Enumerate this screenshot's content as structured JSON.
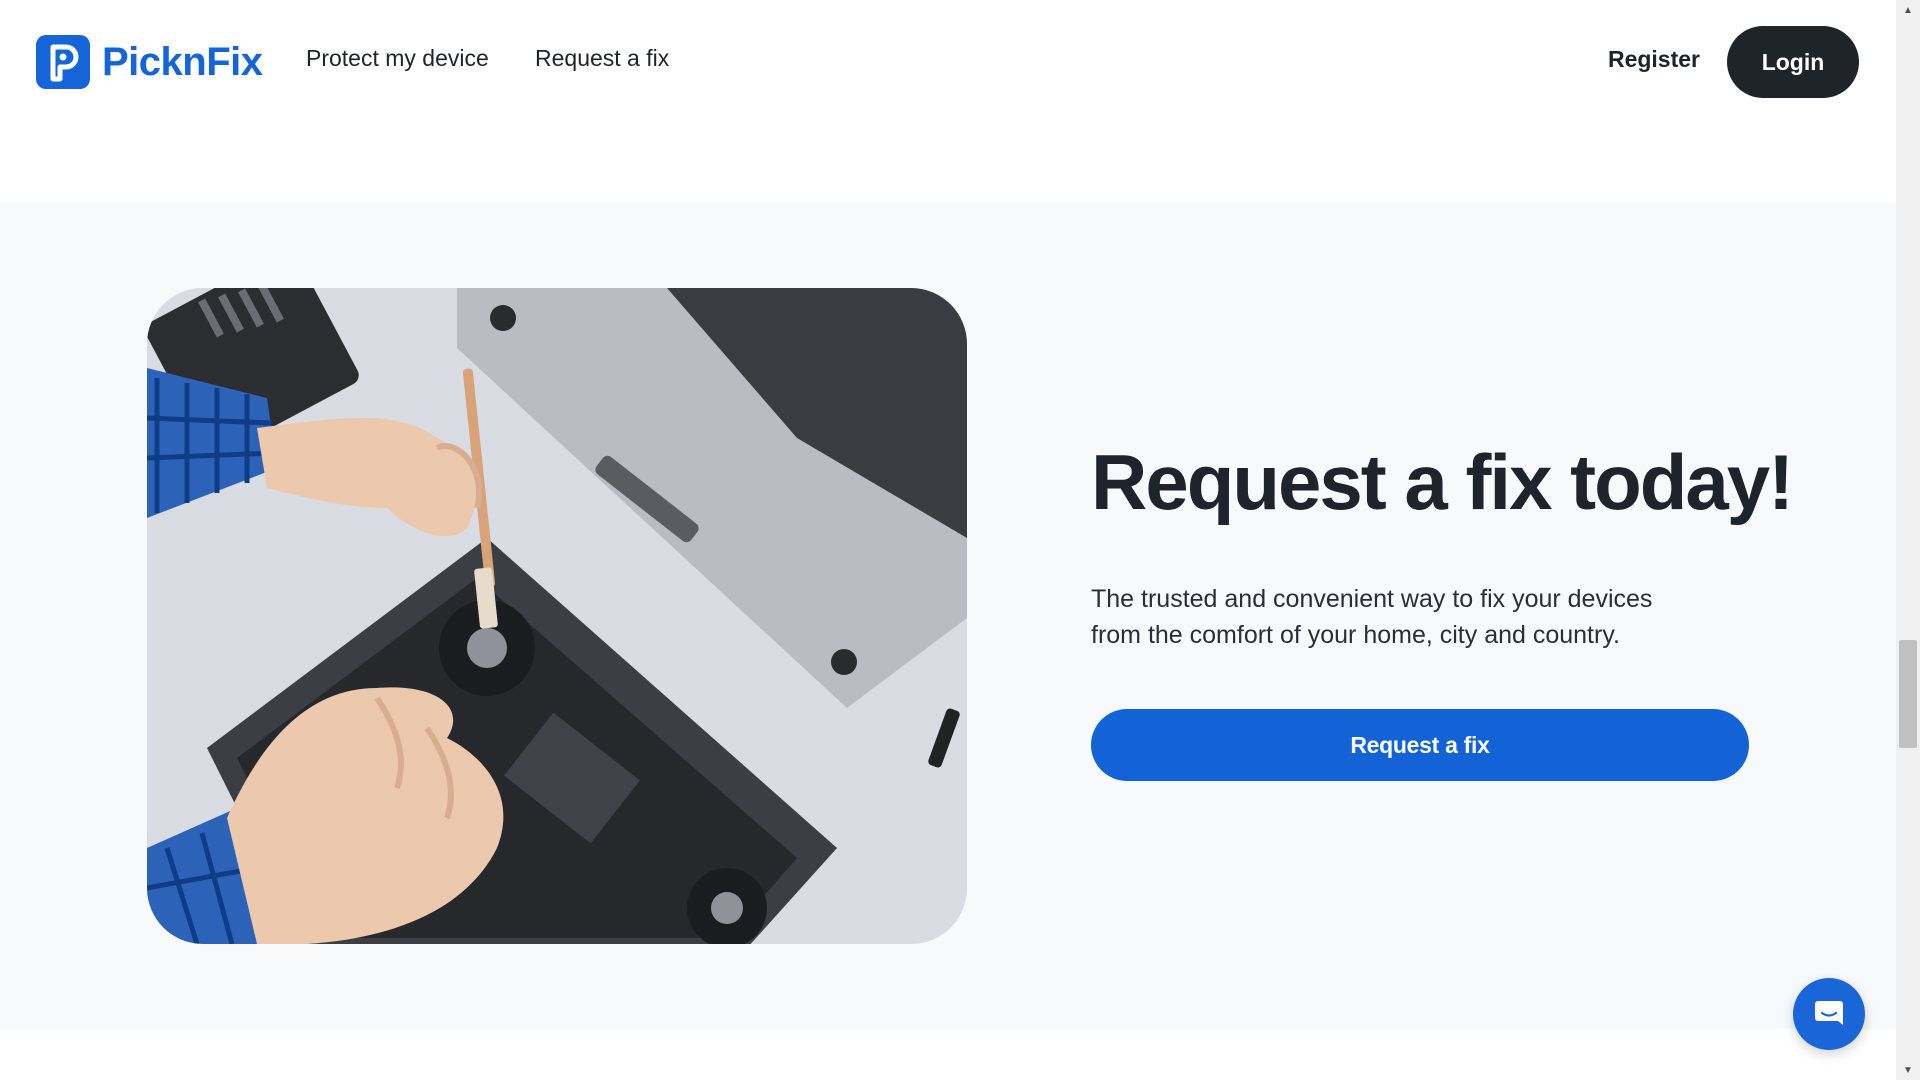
{
  "header": {
    "brand": "PicknFix",
    "nav": [
      {
        "label": "Protect my device"
      },
      {
        "label": "Request a fix"
      }
    ],
    "register_label": "Register",
    "login_label": "Login"
  },
  "hero": {
    "image_alt": "Technician cleaning laptop fan with a brush",
    "title": "Request a fix today!",
    "body_line1": "The trusted and convenient way to fix your devices",
    "body_line2": "from the comfort of your home, city and country.",
    "cta_label": "Request a fix"
  },
  "chat": {
    "icon": "chat-bubble-icon"
  },
  "colors": {
    "brand_blue": "#1565d8",
    "cta_blue": "#1363d6",
    "login_dark": "#1f2428",
    "text_dark": "#1f232b",
    "section_bg": "#f8f9fb"
  }
}
